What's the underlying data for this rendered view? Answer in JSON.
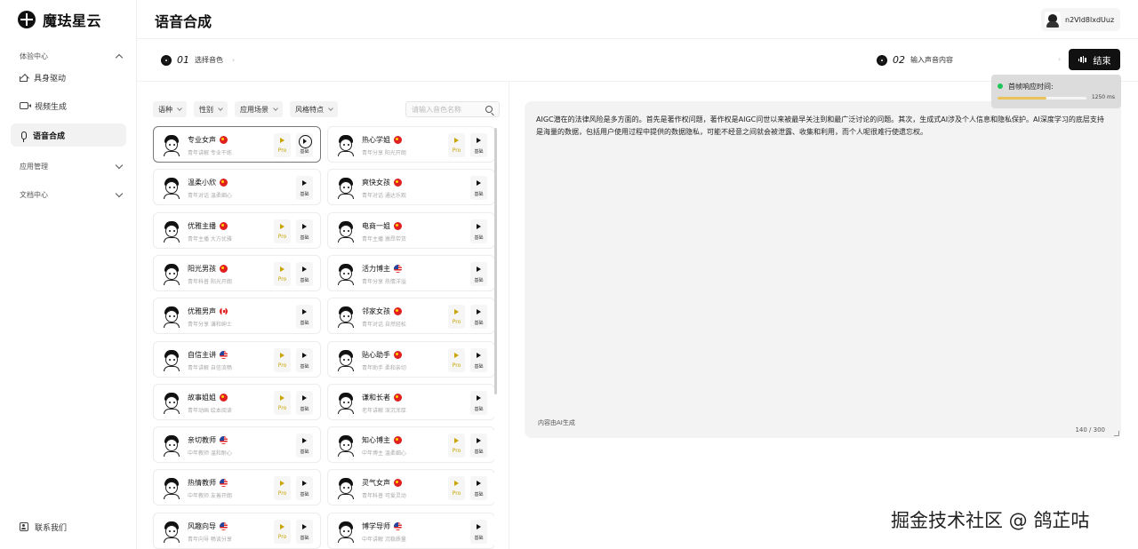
{
  "app": {
    "brand": "魔珐星云",
    "page_title": "语音合成",
    "user_name": "n2Vld8lxdUuz"
  },
  "sidebar": {
    "groups": [
      {
        "label": "体验中心"
      },
      {
        "label": "应用管理"
      },
      {
        "label": "文档中心"
      }
    ],
    "items": [
      {
        "label": "具身驱动",
        "icon": "home-icon"
      },
      {
        "label": "视频生成",
        "icon": "video-icon"
      },
      {
        "label": "语音合成",
        "icon": "mic-icon",
        "active": true
      }
    ],
    "contact": "联系我们"
  },
  "steps": [
    {
      "num": "01",
      "label": "选择音色"
    },
    {
      "num": "02",
      "label": "输入声音内容"
    }
  ],
  "end_button": "结束",
  "filters": [
    "语种",
    "性别",
    "应用场景",
    "风格特点"
  ],
  "search": {
    "placeholder": "请输入音色名称"
  },
  "voices": [
    {
      "name": "专业女声",
      "flag": "cn",
      "tags": "青年讲解 专业干练",
      "pro": true,
      "selected": true,
      "basic_label": "基础",
      "pro_label": "Pro"
    },
    {
      "name": "热心学姐",
      "flag": "cn",
      "tags": "青年分享 阳光开朗",
      "pro": true,
      "basic_label": "基础",
      "pro_label": "Pro"
    },
    {
      "name": "温柔小欣",
      "flag": "cn",
      "tags": "青年对话 温柔细心",
      "pro": false,
      "basic_label": "基础"
    },
    {
      "name": "爽快女孩",
      "flag": "cn",
      "tags": "青年对话 通达乐观",
      "pro": false,
      "basic_label": "基础"
    },
    {
      "name": "优雅主播",
      "flag": "cn",
      "tags": "青年主播 大方优雅",
      "pro": true,
      "basic_label": "基础",
      "pro_label": "Pro"
    },
    {
      "name": "电商一姐",
      "flag": "cn",
      "tags": "青年主播 激昂带货",
      "pro": false,
      "basic_label": "基础"
    },
    {
      "name": "阳光男孩",
      "flag": "cn",
      "tags": "青年科普 阳光开朗",
      "pro": true,
      "basic_label": "基础",
      "pro_label": "Pro"
    },
    {
      "name": "活力博主",
      "flag": "us",
      "tags": "青年分享 热情洋溢",
      "pro": false,
      "basic_label": "基础"
    },
    {
      "name": "优雅男声",
      "flag": "ca",
      "tags": "青年分享 谦和绅士",
      "pro": false,
      "basic_label": "基础"
    },
    {
      "name": "邻家女孩",
      "flag": "cn",
      "tags": "青年对话 自然轻松",
      "pro": true,
      "basic_label": "基础",
      "pro_label": "Pro"
    },
    {
      "name": "自信主讲",
      "flag": "us",
      "tags": "青年讲解 自信流畅",
      "pro": true,
      "basic_label": "基础",
      "pro_label": "Pro"
    },
    {
      "name": "贴心助手",
      "flag": "cn",
      "tags": "青年助手 柔和亲切",
      "pro": true,
      "basic_label": "基础",
      "pro_label": "Pro"
    },
    {
      "name": "故事姐姐",
      "flag": "cn",
      "tags": "青年动画 绘本阅读",
      "pro": true,
      "basic_label": "基础",
      "pro_label": "Pro"
    },
    {
      "name": "谦和长者",
      "flag": "cn",
      "tags": "老年讲解 深沉浑厚",
      "pro": false,
      "basic_label": "基础"
    },
    {
      "name": "亲切教师",
      "flag": "us",
      "tags": "中年教师 温和耐心",
      "pro": false,
      "basic_label": "基础"
    },
    {
      "name": "知心博主",
      "flag": "cn",
      "tags": "中年博主 温柔细心",
      "pro": true,
      "basic_label": "基础",
      "pro_label": "Pro"
    },
    {
      "name": "热情教师",
      "flag": "us",
      "tags": "中年教师 友善开朗",
      "pro": true,
      "basic_label": "基础",
      "pro_label": "Pro"
    },
    {
      "name": "灵气女声",
      "flag": "cn",
      "tags": "青年科普 可爱灵动",
      "pro": true,
      "basic_label": "基础",
      "pro_label": "Pro"
    },
    {
      "name": "风趣向导",
      "flag": "us",
      "tags": "青年向导 畅谈分享",
      "pro": true,
      "basic_label": "基础",
      "pro_label": "Pro"
    },
    {
      "name": "博学导师",
      "flag": "us",
      "tags": "中年讲解 沉稳质量",
      "pro": false,
      "basic_label": "基础"
    }
  ],
  "editor": {
    "text": "AIGC潜在的法律风险是多方面的。首先是著作权问题，著作权是AIGC问世以来被最早关注到和最广泛讨论的问题。其次，生成式AI涉及个人信息和隐私保护。AI深度学习的底层支持是海量的数据，包括用户使用过程中提供的数据隐私，可能不经意之间就会被泄露、收集和利用，而个人呢很难行使遗忘权。",
    "ai_note": "内容由AI生成",
    "count": "140 / 300"
  },
  "latency": {
    "label": "首帧响应时间:",
    "value": "1250 ms",
    "fraction": 0.55
  },
  "watermark": "掘金技术社区 @ 鸽芷咕",
  "colors": {
    "accent": "#111111",
    "pro": "#c9a400",
    "latency_dot": "#1ec45a",
    "latency_bar": "#e9c35a"
  }
}
